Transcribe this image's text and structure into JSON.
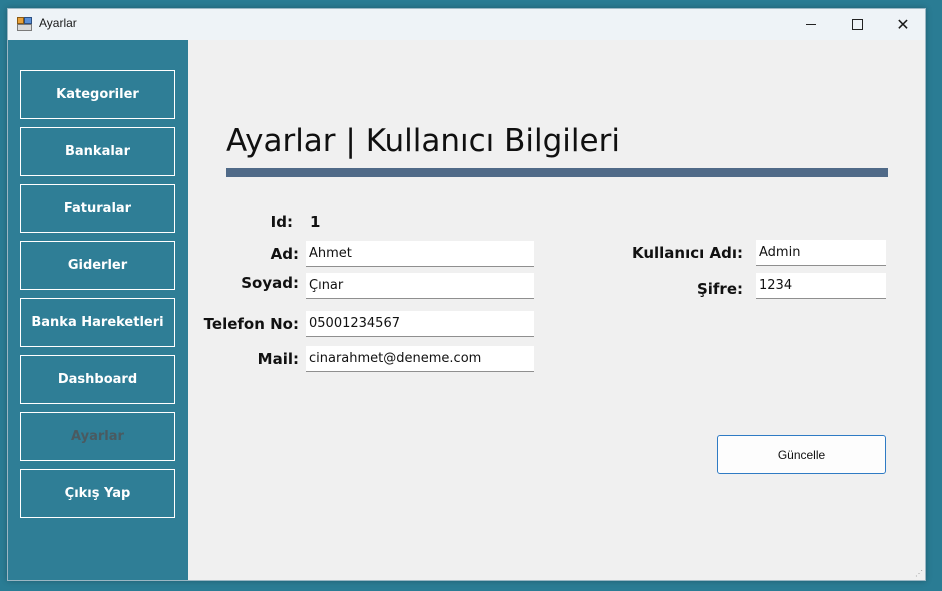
{
  "window": {
    "title": "Ayarlar"
  },
  "sidebar": {
    "items": [
      {
        "label": "Kategoriler",
        "active": false
      },
      {
        "label": "Bankalar",
        "active": false
      },
      {
        "label": "Faturalar",
        "active": false
      },
      {
        "label": "Giderler",
        "active": false
      },
      {
        "label": "Banka Hareketleri",
        "active": false
      },
      {
        "label": "Dashboard",
        "active": false
      },
      {
        "label": "Ayarlar",
        "active": true
      },
      {
        "label": "Çıkış Yap",
        "active": false
      }
    ]
  },
  "main": {
    "title": "Ayarlar | Kullanıcı Bilgileri",
    "id_label": "Id:",
    "id_value": "1",
    "ad_label": "Ad:",
    "ad_value": "Ahmet",
    "soyad_label": "Soyad:",
    "soyad_value": "Çınar",
    "telefon_label": "Telefon No:",
    "telefon_value": "05001234567",
    "mail_label": "Mail:",
    "mail_value": "cinarahmet@deneme.com",
    "kullanici_label": "Kullanıcı Adı:",
    "kullanici_value": "Admin",
    "sifre_label": "Şifre:",
    "sifre_value": "1234",
    "update_label": "Güncelle"
  },
  "colors": {
    "sidebar_bg": "#2f7e96",
    "title_rule": "#506a88",
    "button_border": "#2f7bc4"
  }
}
